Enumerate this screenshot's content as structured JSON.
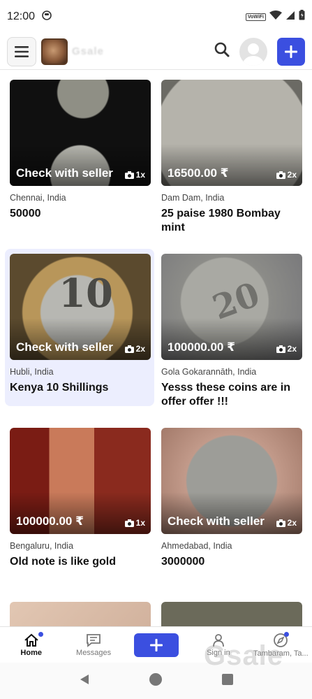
{
  "status_bar": {
    "time": "12:00",
    "vowifi": "VoWiFi"
  },
  "header": {
    "logo_text": "Gsale"
  },
  "listings": [
    {
      "price": "Check with seller",
      "photos": "1x",
      "location": "Chennai, India",
      "title": "50000"
    },
    {
      "price": "16500.00 ₹",
      "photos": "2x",
      "location": "Dam Dam, India",
      "title": "25 paise 1980 Bombay mint"
    },
    {
      "price": "Check with seller",
      "photos": "2x",
      "location": "Hubli, India",
      "title": "Kenya 10 Shillings",
      "image_text": "10"
    },
    {
      "price": "100000.00 ₹",
      "photos": "2x",
      "location": "Gola Gokarannāth, India",
      "title": "Yesss these coins are in offer offer !!!",
      "image_text": "20"
    },
    {
      "price": "100000.00 ₹",
      "photos": "1x",
      "location": "Bengaluru, India",
      "title": "Old note is like gold"
    },
    {
      "price": "Check with seller",
      "photos": "2x",
      "location": "Ahmedabad, India",
      "title": "3000000"
    }
  ],
  "bottom_nav": {
    "home": "Home",
    "messages": "Messages",
    "sign_in": "Sign in",
    "location": "Tambaram, Ta..."
  },
  "watermark": "Gsale",
  "colors": {
    "accent": "#3b4fe0",
    "highlight_bg": "#eceefe"
  }
}
